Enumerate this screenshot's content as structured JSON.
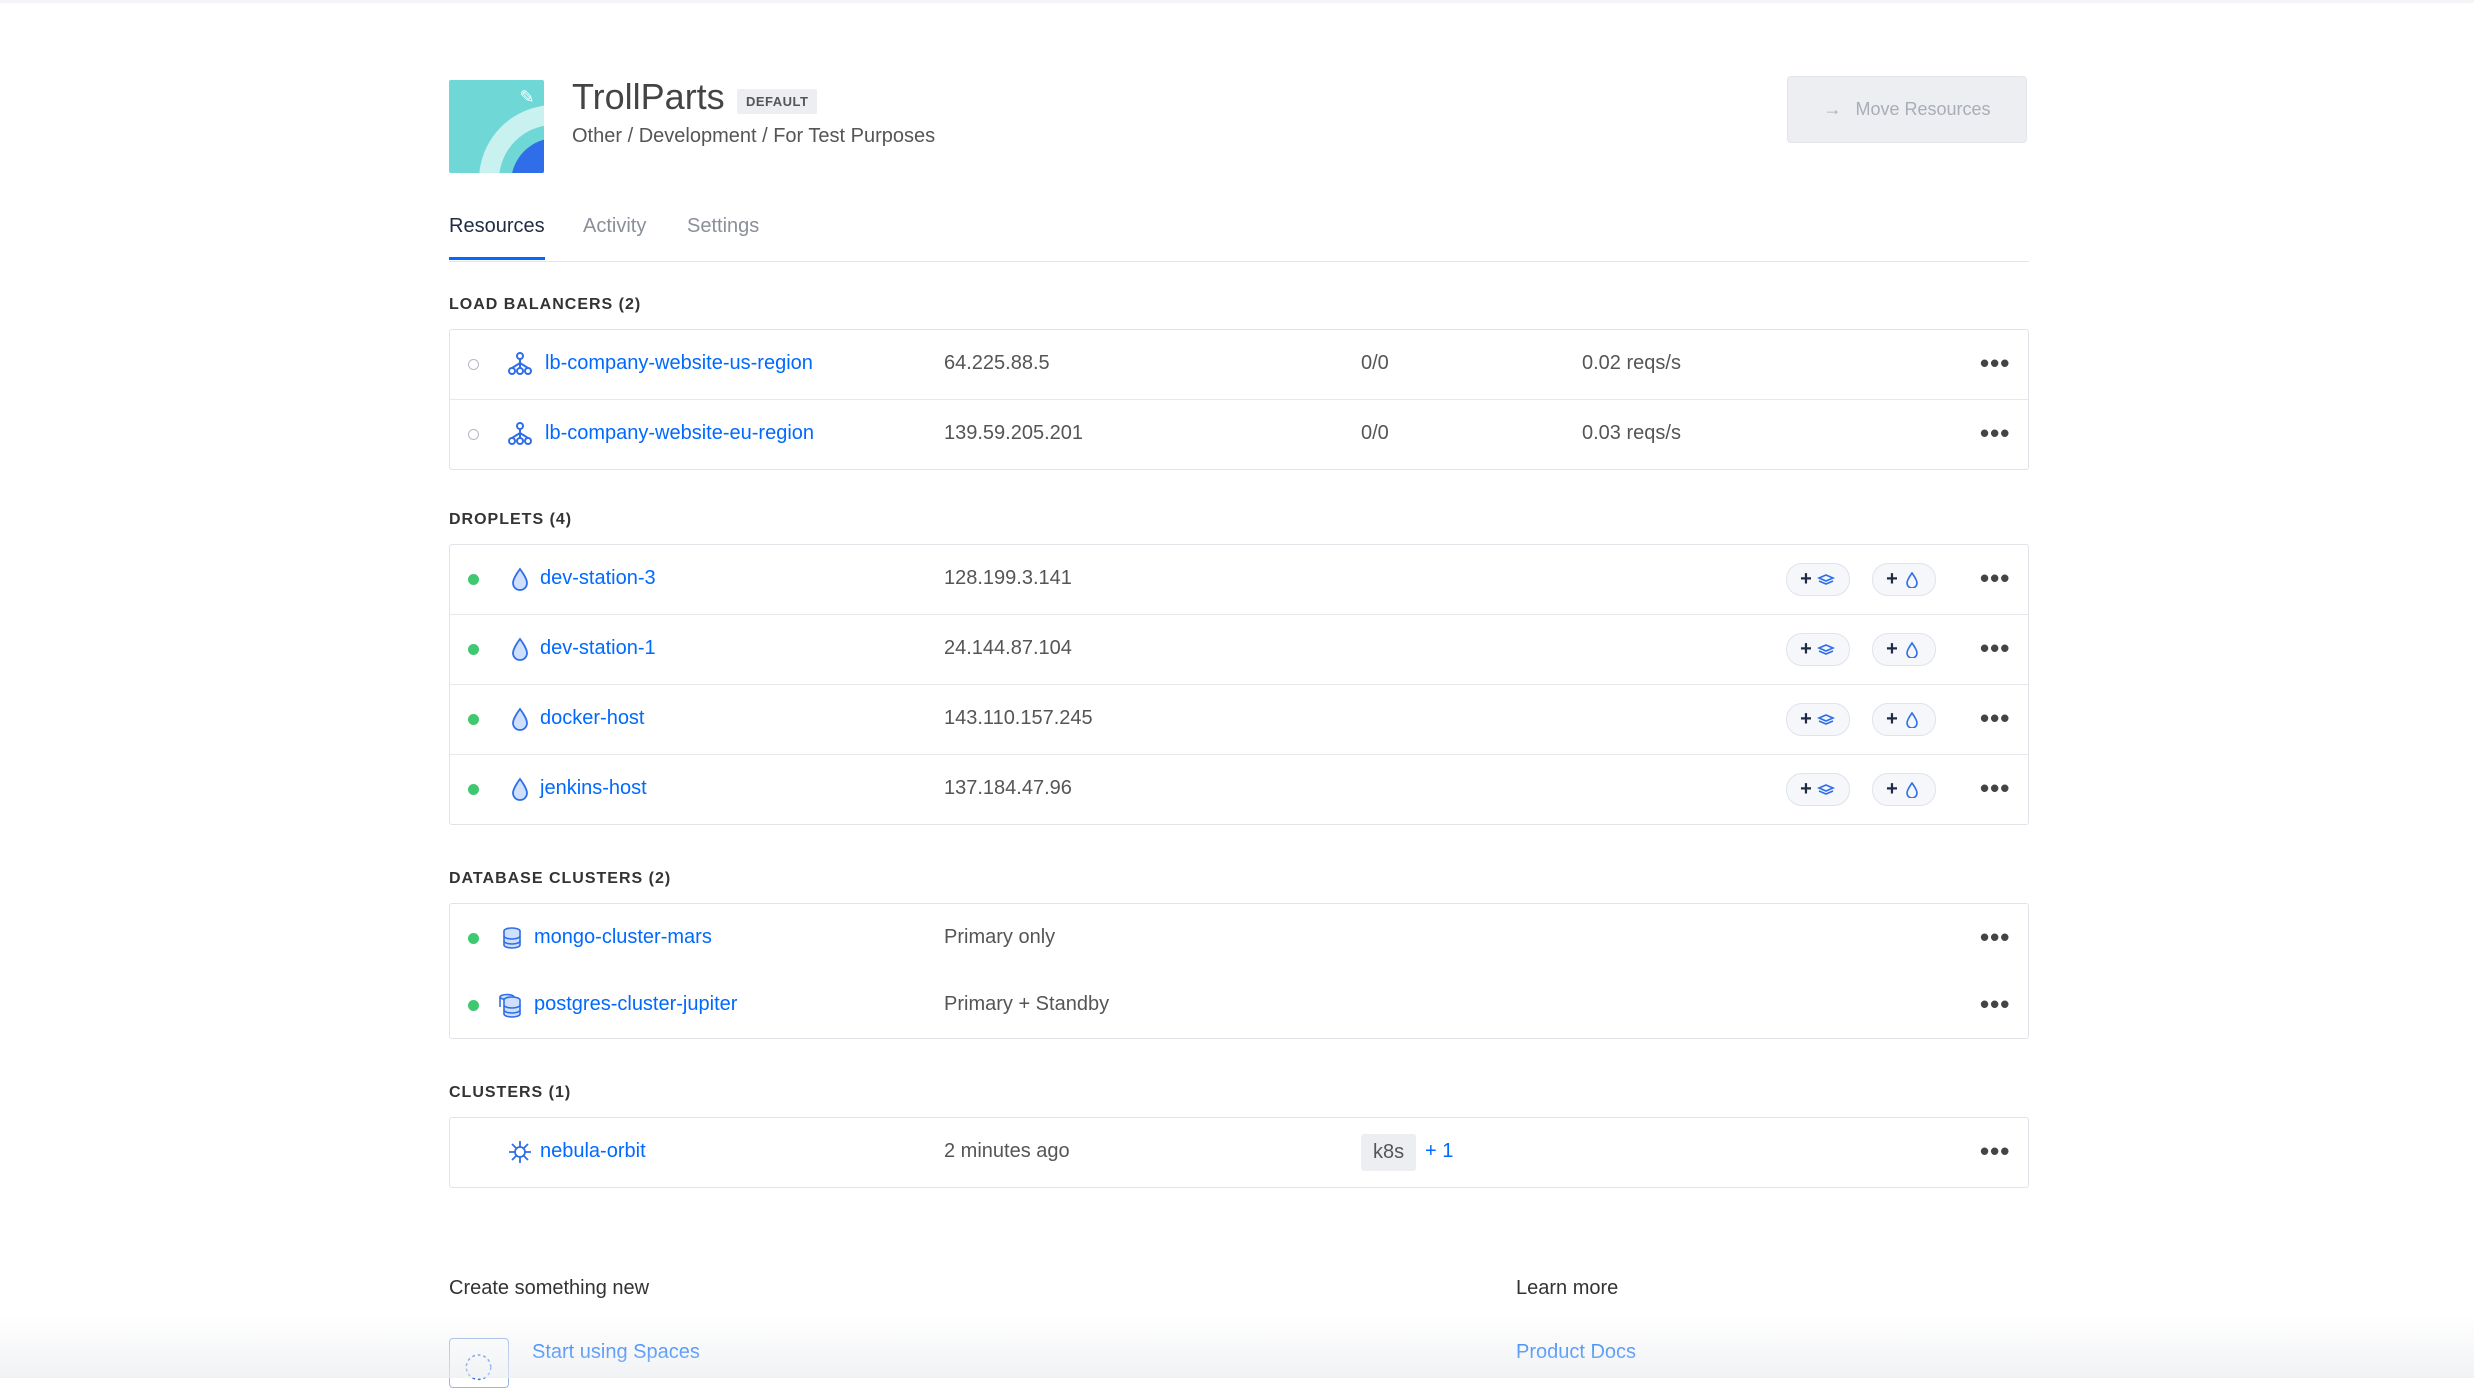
{
  "project": {
    "title": "TrollParts",
    "badge": "DEFAULT",
    "path": "Other / Development / For Test Purposes",
    "move_label": "Move Resources",
    "colors": {
      "accent": "#0069ff",
      "icon_teal": "#6fd8d6",
      "status_green": "#3ec86f"
    }
  },
  "tabs": [
    {
      "label": "Resources",
      "active": true
    },
    {
      "label": "Activity",
      "active": false
    },
    {
      "label": "Settings",
      "active": false
    }
  ],
  "load_balancers": {
    "title": "LOAD BALANCERS (2)",
    "rows": [
      {
        "name": "lb-company-website-us-region",
        "ip": "64.225.88.5",
        "health": "0/0",
        "rate": "0.02 reqs/s"
      },
      {
        "name": "lb-company-website-eu-region",
        "ip": "139.59.205.201",
        "health": "0/0",
        "rate": "0.03 reqs/s"
      }
    ]
  },
  "droplets": {
    "title": "DROPLETS (4)",
    "rows": [
      {
        "name": "dev-station-3",
        "ip": "128.199.3.141"
      },
      {
        "name": "dev-station-1",
        "ip": "24.144.87.104"
      },
      {
        "name": "docker-host",
        "ip": "143.110.157.245"
      },
      {
        "name": "jenkins-host",
        "ip": "137.184.47.96"
      }
    ],
    "add_symbol": "+"
  },
  "databases": {
    "title": "DATABASE CLUSTERS (2)",
    "rows": [
      {
        "name": "mongo-cluster-mars",
        "mode": "Primary only"
      },
      {
        "name": "postgres-cluster-jupiter",
        "mode": "Primary + Standby"
      }
    ]
  },
  "clusters": {
    "title": "CLUSTERS (1)",
    "rows": [
      {
        "name": "nebula-orbit",
        "updated": "2 minutes ago",
        "tag": "k8s",
        "extra": "+ 1"
      }
    ]
  },
  "more_symbol": "•••",
  "footer": {
    "create_title": "Create something new",
    "create_link": "Start using Spaces",
    "learn_title": "Learn more",
    "learn_link": "Product Docs"
  },
  "icons": [
    "pencil-icon",
    "arrow-right-icon",
    "load-balancer-icon",
    "droplet-icon",
    "database-icon",
    "kubernetes-icon",
    "volume-icon",
    "spaces-icon",
    "more-icon"
  ]
}
